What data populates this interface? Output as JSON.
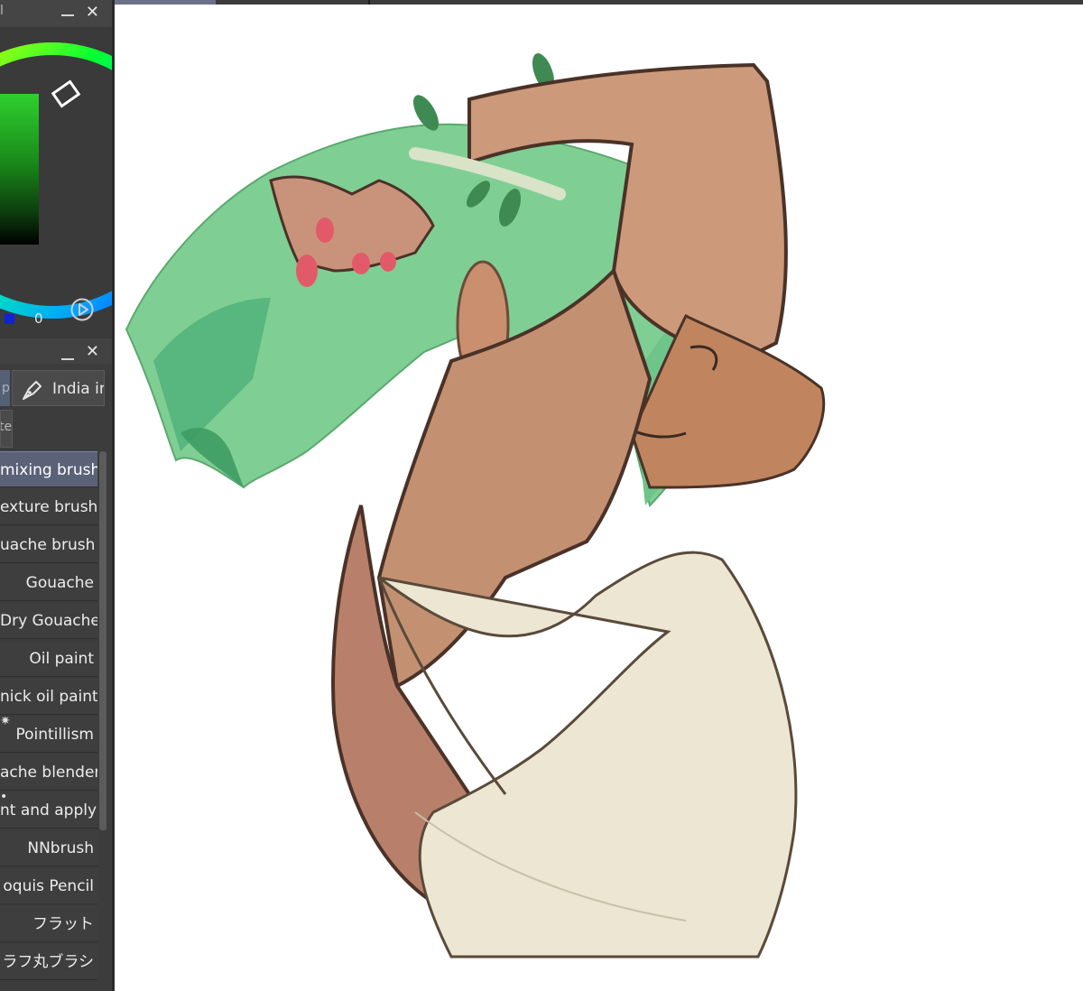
{
  "color_panel": {
    "title_fragment": "l",
    "value_text": "0",
    "accent_color": "#1fd01f",
    "blue_chip_color": "#0d23d8"
  },
  "brush_panel": {
    "tab_partial_label": "p",
    "tab_label": "India ir",
    "subtab_label": "te",
    "brushes": [
      {
        "label": "mixing brush",
        "selected": true
      },
      {
        "label": "exture brush",
        "selected": false
      },
      {
        "label": "uache brush",
        "selected": false
      },
      {
        "label": "Gouache",
        "selected": false
      },
      {
        "label": "Dry Gouache",
        "selected": false
      },
      {
        "label": "Oil paint",
        "selected": false
      },
      {
        "label": "nick oil paint",
        "selected": false
      },
      {
        "label": "Pointillism",
        "selected": false
      },
      {
        "label": "ache blender",
        "selected": false
      },
      {
        "label": "nt and apply",
        "selected": false
      },
      {
        "label": "NNbrush",
        "selected": false
      },
      {
        "label": "oquis Pencil",
        "selected": false
      },
      {
        "label": "フラット",
        "selected": false
      },
      {
        "label": "ラフ丸ブラシ",
        "selected": false
      }
    ]
  },
  "icons": {
    "close": "close-icon",
    "minimize": "minimize-icon",
    "play": "play-circle-icon",
    "pen": "pen-nib-icon"
  }
}
